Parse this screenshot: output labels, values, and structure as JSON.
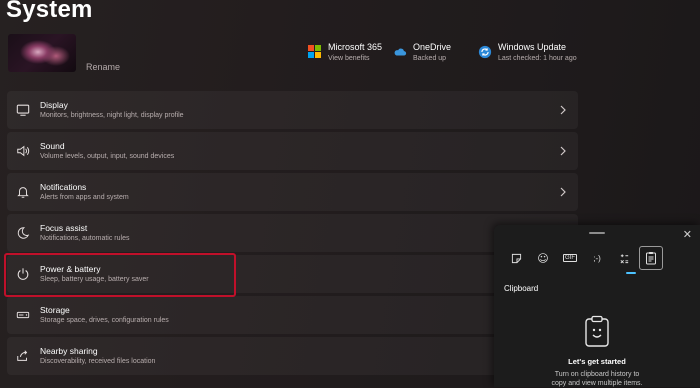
{
  "page": {
    "title": "System"
  },
  "device": {
    "rename_label": "Rename"
  },
  "status": [
    {
      "title": "Microsoft 365",
      "subtitle": "View benefits",
      "icon": "microsoft-365-icon"
    },
    {
      "title": "OneDrive",
      "subtitle": "Backed up",
      "icon": "onedrive-cloud-icon"
    },
    {
      "title": "Windows Update",
      "subtitle": "Last checked: 1 hour ago",
      "icon": "windows-update-icon"
    }
  ],
  "settings": [
    {
      "title": "Display",
      "subtitle": "Monitors, brightness, night light, display profile",
      "icon": "display-icon"
    },
    {
      "title": "Sound",
      "subtitle": "Volume levels, output, input, sound devices",
      "icon": "speaker-icon"
    },
    {
      "title": "Notifications",
      "subtitle": "Alerts from apps and system",
      "icon": "bell-icon"
    },
    {
      "title": "Focus assist",
      "subtitle": "Notifications, automatic rules",
      "icon": "moon-icon"
    },
    {
      "title": "Power & battery",
      "subtitle": "Sleep, battery usage, battery saver",
      "icon": "power-icon"
    },
    {
      "title": "Storage",
      "subtitle": "Storage space, drives, configuration rules",
      "icon": "storage-drive-icon"
    },
    {
      "title": "Nearby sharing",
      "subtitle": "Discoverability, received files location",
      "icon": "share-icon"
    }
  ],
  "clipboard_panel": {
    "tabs": [
      {
        "icon": "sticker-icon",
        "glyph": ""
      },
      {
        "icon": "emoji-icon",
        "glyph": "☺"
      },
      {
        "icon": "gif-icon",
        "glyph": "GIF"
      },
      {
        "icon": "kaomoji-icon",
        "glyph": ";-)"
      },
      {
        "icon": "symbols-icon",
        "glyph": ""
      },
      {
        "icon": "clipboard-icon",
        "glyph": ""
      }
    ],
    "active_tab": "clipboard",
    "section_title": "Clipboard",
    "heading": "Let's get started",
    "description_line1": "Turn on clipboard history to",
    "description_line2": "copy and view multiple items."
  },
  "colors": {
    "highlight_border": "#c0102a",
    "accent": "#4cc2ff"
  }
}
